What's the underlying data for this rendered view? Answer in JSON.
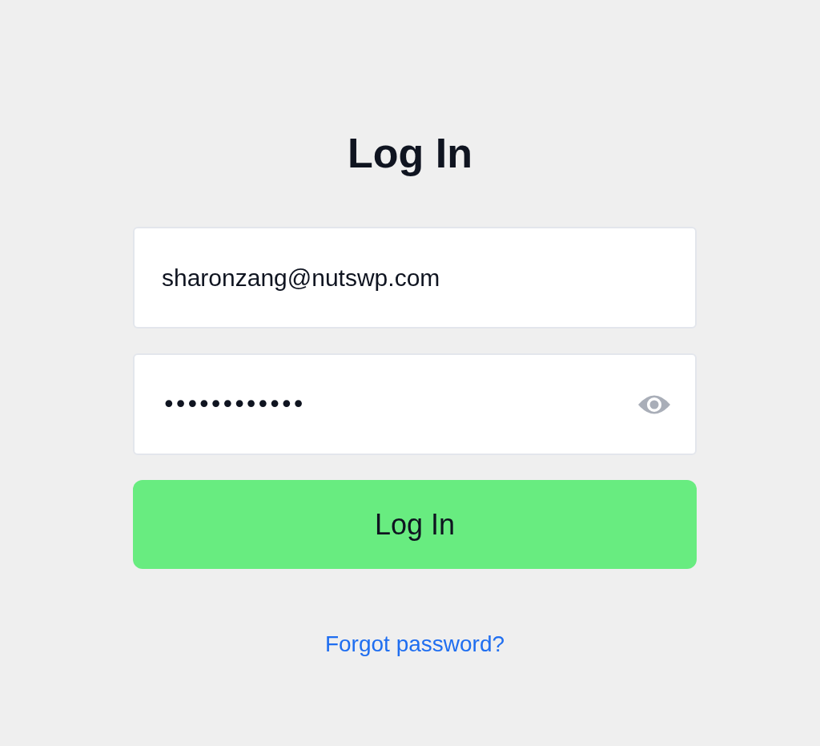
{
  "title": "Log In",
  "email_field": {
    "value": "sharonzang@nutswp.com"
  },
  "password_field": {
    "value": "••••••••••••"
  },
  "login_button": {
    "label": "Log In"
  },
  "forgot_link": {
    "label": "Forgot password?"
  }
}
